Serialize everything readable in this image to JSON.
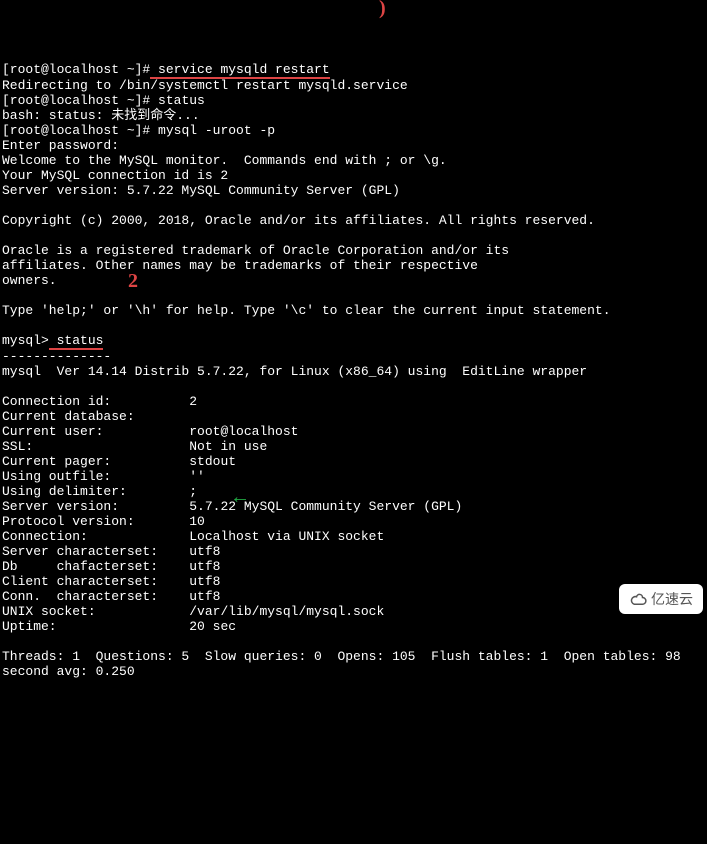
{
  "prompt1": {
    "prefix": "[root@localhost ~]#",
    "cmd": " service mysqld restart"
  },
  "redirect": "Redirecting to /bin/systemctl restart mysqld.service",
  "prompt2": {
    "prefix": "[root@localhost ~]#",
    "cmd": " status"
  },
  "bash_err": "bash: status: 未找到命令...",
  "prompt3": {
    "prefix": "[root@localhost ~]#",
    "cmd": " mysql -uroot -p"
  },
  "enter_pw": "Enter password:",
  "welcome1": "Welcome to the MySQL monitor.  Commands end with ; or \\g.",
  "welcome2": "Your MySQL connection id is 2",
  "welcome3": "Server version: 5.7.22 MySQL Community Server (GPL)",
  "copyright": "Copyright (c) 2000, 2018, Oracle and/or its affiliates. All rights reserved.",
  "trademark1": "Oracle is a registered trademark of Oracle Corporation and/or its",
  "trademark2": "affiliates. Other names may be trademarks of their respective",
  "trademark3": "owners.",
  "help": "Type 'help;' or '\\h' for help. Type '\\c' to clear the current input statement.",
  "mysql_prompt": {
    "prefix": "mysql>",
    "cmd": " status"
  },
  "dashes": "--------------",
  "ver": "mysql  Ver 14.14 Distrib 5.7.22, for Linux (x86_64) using  EditLine wrapper",
  "status": {
    "conn_id": {
      "k": "Connection id:          ",
      "v": "2"
    },
    "cur_db": {
      "k": "Current database:",
      "v": ""
    },
    "cur_user": {
      "k": "Current user:           ",
      "v": "root@localhost"
    },
    "ssl": {
      "k": "SSL:                    ",
      "v": "Not in use"
    },
    "pager": {
      "k": "Current pager:          ",
      "v": "stdout"
    },
    "outfile": {
      "k": "Using outfile:          ",
      "v": "''"
    },
    "delimiter": {
      "k": "Using delimiter:        ",
      "v": ";"
    },
    "server_ver": {
      "k": "Server version:         ",
      "v": "5.7.22 MySQL Community Server (GPL)"
    },
    "proto": {
      "k": "Protocol version:       ",
      "v": "10"
    },
    "connection": {
      "k": "Connection:             ",
      "v": "Localhost via UNIX socket"
    },
    "server_cs": {
      "k": "Server characterset:    ",
      "v": "utf8"
    },
    "db_cs": {
      "k": "Db     chafacterset:    ",
      "v": "utf8"
    },
    "client_cs": {
      "k": "Client characterset:    ",
      "v": "utf8"
    },
    "conn_cs": {
      "k": "Conn.  characterset:    ",
      "v": "utf8"
    },
    "sock": {
      "k": "UNIX socket:            ",
      "v": "/var/lib/mysql/mysql.sock"
    },
    "uptime": {
      "k": "Uptime:                 ",
      "v": "20 sec"
    }
  },
  "threads": "Threads: 1  Questions: 5  Slow queries: 0  Opens: 105  Flush tables: 1  Open tables: 98",
  "secavg": "second avg: 0.250",
  "watermark": "亿速云"
}
